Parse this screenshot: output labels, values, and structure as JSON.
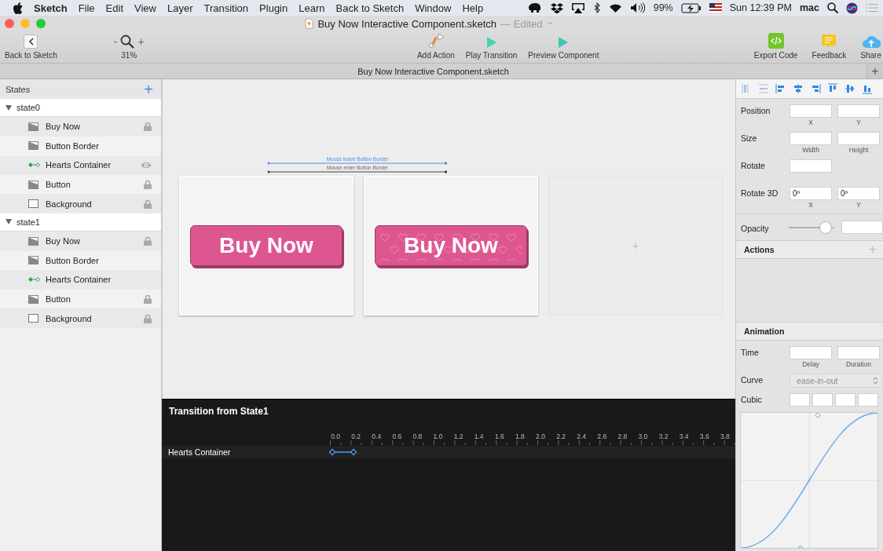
{
  "menubar": {
    "app": "Sketch",
    "items": [
      "File",
      "Edit",
      "View",
      "Layer",
      "Transition",
      "Plugin",
      "Learn",
      "Back to Sketch",
      "Window",
      "Help"
    ],
    "battery": "99%",
    "clock": "Sun 12:39 PM",
    "user": "mac"
  },
  "window": {
    "title": "Buy Now Interactive Component.sketch",
    "edited": "— Edited"
  },
  "toolbar": {
    "left": [
      {
        "kind": "back",
        "label": "Back to Sketch"
      },
      {
        "kind": "zoom",
        "label": "31%",
        "minus": "-",
        "plus": "+"
      }
    ],
    "center": [
      {
        "kind": "action",
        "label": "Add Action"
      },
      {
        "kind": "play",
        "label": "Play Transition"
      },
      {
        "kind": "preview",
        "label": "Preview Component"
      }
    ],
    "right": [
      {
        "kind": "export",
        "label": "Export Code"
      },
      {
        "kind": "feedback",
        "label": "Feedback"
      },
      {
        "kind": "share",
        "label": "Share"
      }
    ]
  },
  "tab": {
    "label": "Buy Now Interactive Component.sketch",
    "add": "+"
  },
  "states": {
    "title": "States",
    "add": "+",
    "groups": [
      {
        "name": "state0",
        "expanded": true,
        "children": [
          {
            "name": "Buy Now",
            "kind": "image",
            "locked": true,
            "eye": false
          },
          {
            "name": "Button Border",
            "kind": "image",
            "locked": false,
            "eye": false
          },
          {
            "name": "Hearts Container",
            "kind": "group",
            "locked": false,
            "eye": true
          },
          {
            "name": "Button",
            "kind": "image",
            "locked": true,
            "eye": false
          },
          {
            "name": "Background",
            "kind": "rect",
            "locked": true,
            "eye": false
          }
        ]
      },
      {
        "name": "state1",
        "expanded": true,
        "children": [
          {
            "name": "Buy Now",
            "kind": "image",
            "locked": true,
            "eye": false
          },
          {
            "name": "Button Border",
            "kind": "image",
            "locked": false,
            "eye": false
          },
          {
            "name": "Hearts Container",
            "kind": "group",
            "locked": false,
            "eye": false
          },
          {
            "name": "Button",
            "kind": "image",
            "locked": true,
            "eye": false
          },
          {
            "name": "Background",
            "kind": "rect",
            "locked": true,
            "eye": false
          }
        ]
      }
    ]
  },
  "canvas": {
    "connectors": [
      {
        "kind": "leave",
        "label": "Mouse leave Button Border"
      },
      {
        "kind": "enter",
        "label": "Mouse enter Button Border"
      }
    ],
    "artboards": [
      {
        "kind": "button",
        "label": "Buy Now",
        "hearts": false
      },
      {
        "kind": "button",
        "label": "Buy Now",
        "hearts": true
      },
      {
        "kind": "empty",
        "add": "+"
      }
    ]
  },
  "timeline": {
    "title": "Transition from State1",
    "ticks": [
      "0.0",
      "0.2",
      "0.4",
      "0.6",
      "0.8",
      "1.0",
      "1.2",
      "1.4",
      "1.6",
      "1.8",
      "2.0",
      "2.2",
      "2.4",
      "2.6",
      "2.8",
      "3.0",
      "3.2",
      "3.4",
      "3.6",
      "3.8"
    ],
    "tracks": [
      {
        "name": "Hearts Container"
      }
    ]
  },
  "inspector": {
    "rows": [
      {
        "label": "Position",
        "fields": [
          {
            "caption": "X"
          },
          {
            "caption": "Y"
          }
        ]
      },
      {
        "label": "Size",
        "fields": [
          {
            "caption": "Width"
          },
          {
            "caption": "Height"
          }
        ]
      },
      {
        "label": "Rotate",
        "kind": "single"
      },
      {
        "label": "Rotate 3D",
        "fields": [
          {
            "value": "0º",
            "caption": "X"
          },
          {
            "value": "0º",
            "caption": "Y"
          }
        ]
      }
    ],
    "opacity": {
      "label": "Opacity",
      "level": 0.87
    },
    "actions": {
      "title": "Actions",
      "add": "+"
    },
    "animation": {
      "title": "Animation",
      "time": {
        "label": "Time",
        "fields": [
          {
            "caption": "Delay"
          },
          {
            "caption": "Duration"
          }
        ]
      },
      "curve": {
        "label": "Curve",
        "value": "ease-in-out"
      },
      "cubic": {
        "label": "Cubic"
      }
    }
  }
}
